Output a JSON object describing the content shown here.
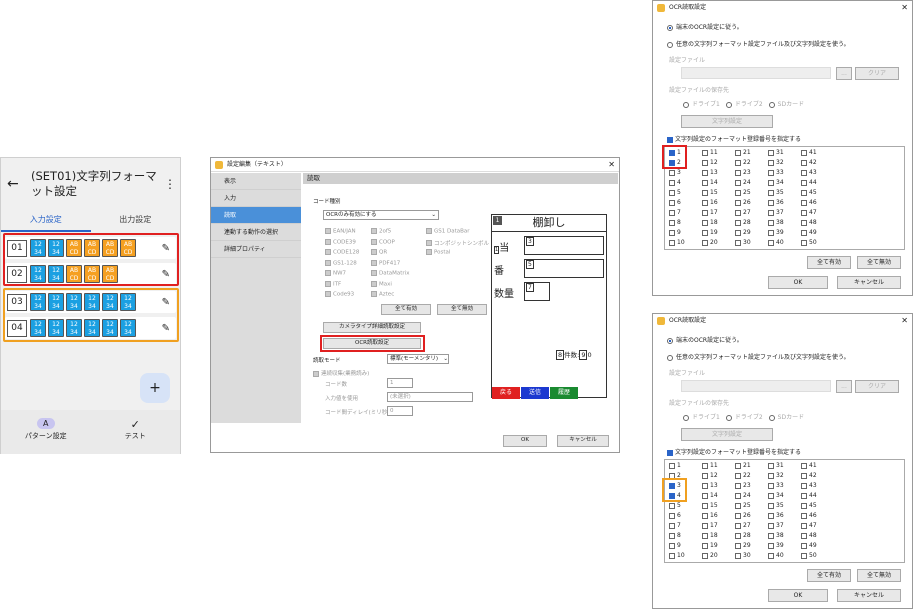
{
  "phone": {
    "title": "(SET01)文字列フォーマット設定",
    "tab_input": "入力設定",
    "tab_output": "出力設定",
    "rows": [
      {
        "num": "01",
        "chips": [
          "blue",
          "blue",
          "orange",
          "orange",
          "orange",
          "orange"
        ]
      },
      {
        "num": "02",
        "chips": [
          "blue",
          "blue",
          "orange",
          "orange",
          "orange"
        ]
      },
      {
        "num": "03",
        "chips": [
          "blue",
          "blue",
          "blue",
          "blue",
          "blue",
          "blue"
        ]
      },
      {
        "num": "04",
        "chips": [
          "blue",
          "blue",
          "blue",
          "blue",
          "blue",
          "blue"
        ]
      }
    ],
    "chip_blue_text": "12 34",
    "chip_orange_text": "AB CD",
    "fab": "+",
    "nav_pattern": "パターン設定",
    "nav_test": "テスト",
    "nav_icon_letter": "A"
  },
  "settings": {
    "title": "設定編集（テキスト）",
    "side": [
      "表示",
      "入力",
      "読取",
      "連動する動作の選択",
      "詳細プロパティ"
    ],
    "header": "読取",
    "code_type_label": "コード種別",
    "code_combo": "OCRのみ有効にする",
    "codes_col1": [
      "EAN/JAN",
      "CODE39",
      "CODE128",
      "GS1-128",
      "NW7",
      "ITF",
      "Code93"
    ],
    "codes_col2": [
      "2of5",
      "COOP",
      "QR",
      "PDF417",
      "DataMatrix",
      "Maxi",
      "Aztec"
    ],
    "codes_col3": [
      "GS1 DataBar",
      "コンポジットシンボル",
      "Postal"
    ],
    "btn_all_on": "全て有効",
    "btn_all_off": "全て無効",
    "btn_camera": "カメラタイプ詳細読取設定",
    "btn_ocr": "OCR読取設定",
    "read_mode_label": "読取モード",
    "read_mode_value": "標準(モーメンタリ)",
    "continuous": "連続収集(業務読み)",
    "code_count": "コード数",
    "code_count_value": "1",
    "input_value_label": "入力値を使用",
    "input_value": "(未選択)",
    "delay_label": "コード間ディレイ(ミリ秒)",
    "delay_value": "0",
    "ok": "OK",
    "cancel": "キャンセル",
    "preview": {
      "num1": "1",
      "title": "棚卸し",
      "f2": "当",
      "f3": "3",
      "f4": "番",
      "f5": "5",
      "f6": "数量",
      "f7": "7",
      "c8": "8",
      "count_label": "件数:",
      "c9": "9",
      "c0": "0",
      "btn_back": "戻る",
      "btn_send": "送信",
      "btn_history": "履歴"
    }
  },
  "ocr_top": {
    "title": "OCR読取設定",
    "opt1": "端末のOCR設定に従う。",
    "opt2": "任意の文字列フォーマット設定ファイル及び文字列設定を使う。",
    "file_label": "設定ファイル",
    "browse": "...",
    "clear": "クリア",
    "save_label": "設定ファイルの保存先",
    "drive1": "ドライブ1",
    "drive2": "ドライブ2",
    "sd": "SDカード",
    "str_btn": "文字列設定",
    "specify": "文字列設定のフォーマット登録番号を指定する",
    "checked": [
      1,
      2
    ],
    "all_on": "全て有効",
    "all_off": "全て無効",
    "ok": "OK",
    "cancel": "キャンセル"
  },
  "ocr_bottom": {
    "title": "OCR読取設定",
    "opt1": "端末のOCR設定に従う。",
    "opt2": "任意の文字列フォーマット設定ファイル及び文字列設定を使う。",
    "file_label": "設定ファイル",
    "browse": "...",
    "clear": "クリア",
    "save_label": "設定ファイルの保存先",
    "drive1": "ドライブ1",
    "drive2": "ドライブ2",
    "sd": "SDカード",
    "str_btn": "文字列設定",
    "specify": "文字列設定のフォーマット登録番号を指定する",
    "checked": [
      3,
      4
    ],
    "all_on": "全て有効",
    "all_off": "全て無効",
    "ok": "OK",
    "cancel": "キャンセル"
  },
  "colors": {
    "red": "#e02020",
    "orange": "#f0a020",
    "blue": "#1ba0e2",
    "chip_orange": "#f5a021"
  }
}
